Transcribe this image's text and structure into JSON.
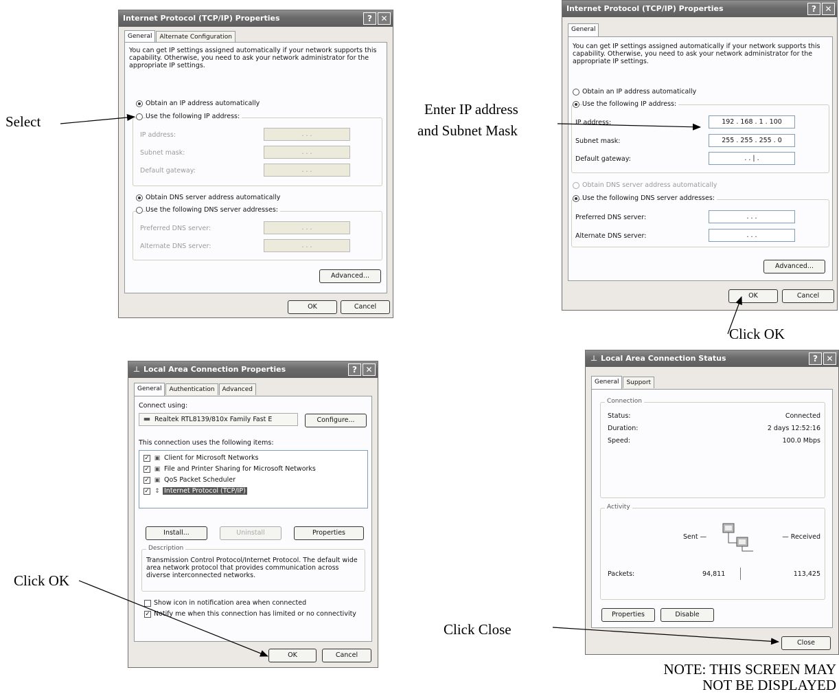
{
  "labels": {
    "select": "Select",
    "enter_ip_line1": "Enter IP address",
    "enter_ip_line2": "and Subnet Mask",
    "click_ok_tcpip": "Click OK",
    "click_ok_lan": "Click OK",
    "click_close": "Click Close",
    "note_line1": "NOTE: THIS SCREEN MAY",
    "note_line2": "NOT BE DISPLAYED"
  },
  "tcpip_dialog": {
    "title": "Internet Protocol (TCP/IP) Properties",
    "help_symbol": "?",
    "close_symbol": "✕",
    "tab_general": "General",
    "tab_alternate": "Alternate Configuration",
    "description": "You can get IP settings assigned automatically if your network supports this capability. Otherwise, you need to ask your network administrator for the appropriate IP settings.",
    "obtain_ip_auto": "Obtain an IP address automatically",
    "use_following_ip": "Use the following IP address:",
    "ip_address_label": "IP address:",
    "subnet_mask_label": "Subnet mask:",
    "default_gateway_label": "Default gateway:",
    "obtain_dns_auto": "Obtain DNS server address automatically",
    "use_following_dns": "Use the following DNS server addresses:",
    "preferred_dns_label": "Preferred DNS server:",
    "alternate_dns_label": "Alternate DNS server:",
    "empty_ip_value": ".       .       .",
    "advanced_button": "Advanced...",
    "ok_button": "OK",
    "cancel_button": "Cancel"
  },
  "tcpip_dialog_filled": {
    "title": "Internet Protocol (TCP/IP) Properties",
    "help_symbol": "?",
    "close_symbol": "✕",
    "tab_general": "General",
    "description": "You can get IP settings assigned automatically if your network supports this capability. Otherwise, you need to ask your network administrator for the appropriate IP settings.",
    "obtain_ip_auto": "Obtain an IP address automatically",
    "use_following_ip": "Use the following IP address:",
    "ip_address_label": "IP address:",
    "ip_address_value": "192 . 168 .  1  . 100",
    "subnet_mask_label": "Subnet mask:",
    "subnet_mask_value": "255 . 255 . 255 .  0",
    "default_gateway_label": "Default gateway:",
    "default_gateway_value": ".       .   |   .",
    "obtain_dns_auto": "Obtain DNS server address automatically",
    "use_following_dns": "Use the following DNS server addresses:",
    "preferred_dns_label": "Preferred DNS server:",
    "preferred_dns_value": ".       .       .",
    "alternate_dns_label": "Alternate DNS server:",
    "alternate_dns_value": ".       .       .",
    "advanced_button": "Advanced...",
    "ok_button": "OK",
    "cancel_button": "Cancel"
  },
  "lan_properties": {
    "title": "Local Area Connection Properties",
    "help_symbol": "?",
    "close_symbol": "✕",
    "tab_general": "General",
    "tab_authentication": "Authentication",
    "tab_advanced": "Advanced",
    "connect_using": "Connect using:",
    "adapter": "Realtek RTL8139/810x Family Fast E",
    "configure_button": "Configure...",
    "items_label": "This connection uses the following items:",
    "items": [
      "Client for Microsoft Networks",
      "File and Printer Sharing for Microsoft Networks",
      "QoS Packet Scheduler",
      "Internet Protocol (TCP/IP)"
    ],
    "install_button": "Install...",
    "uninstall_button": "Uninstall",
    "properties_button": "Properties",
    "description_legend": "Description",
    "description_text": "Transmission Control Protocol/Internet Protocol. The default wide area network protocol that provides communication across diverse interconnected networks.",
    "show_icon": "Show icon in notification area when connected",
    "notify": "Notify me when this connection has limited or no connectivity",
    "ok_button": "OK",
    "cancel_button": "Cancel"
  },
  "lan_status": {
    "title": "Local Area Connection Status",
    "help_symbol": "?",
    "close_symbol": "✕",
    "tab_general": "General",
    "tab_support": "Support",
    "connection_legend": "Connection",
    "status_label": "Status:",
    "status_value": "Connected",
    "duration_label": "Duration:",
    "duration_value": "2 days 12:52:16",
    "speed_label": "Speed:",
    "speed_value": "100.0 Mbps",
    "activity_legend": "Activity",
    "sent_label": "Sent —",
    "received_label": "— Received",
    "packets_label": "Packets:",
    "packets_sent": "94,811",
    "packets_received": "113,425",
    "properties_button": "Properties",
    "disable_button": "Disable",
    "close_button": "Close"
  }
}
